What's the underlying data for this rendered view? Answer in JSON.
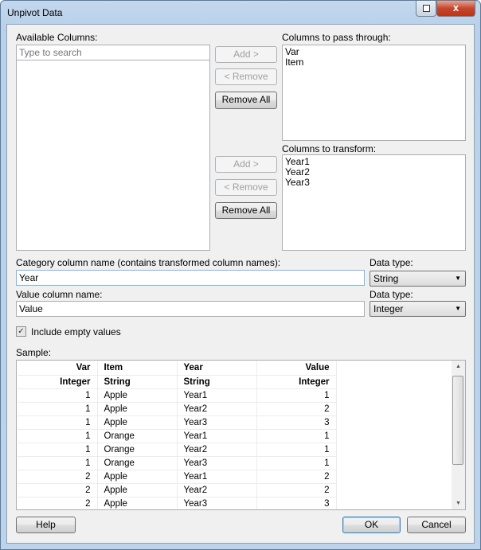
{
  "window": {
    "title": "Unpivot Data",
    "close_label": "x"
  },
  "available": {
    "label": "Available Columns:",
    "search_placeholder": "Type to search",
    "items": []
  },
  "buttons": {
    "add1": "Add >",
    "remove1": "< Remove",
    "remove_all1": "Remove All",
    "add2": "Add >",
    "remove2": "< Remove",
    "remove_all2": "Remove All",
    "help": "Help",
    "ok": "OK",
    "cancel": "Cancel"
  },
  "pass_through": {
    "label": "Columns to pass through:",
    "items": [
      "Var",
      "Item"
    ]
  },
  "transform": {
    "label": "Columns to transform:",
    "items": [
      "Year1",
      "Year2",
      "Year3"
    ]
  },
  "category": {
    "label": "Category column name (contains transformed column names):",
    "value": "Year",
    "type_label": "Data type:",
    "type_value": "String"
  },
  "value_col": {
    "label": "Value column name:",
    "value": "Value",
    "type_label": "Data type:",
    "type_value": "Integer"
  },
  "include_empty": {
    "label": "Include empty values",
    "checked": true
  },
  "sample": {
    "label": "Sample:",
    "headers": [
      "Var",
      "Item",
      "Year",
      "Value"
    ],
    "types": [
      "Integer",
      "String",
      "String",
      "Integer"
    ],
    "rows": [
      [
        "1",
        "Apple",
        "Year1",
        "1"
      ],
      [
        "1",
        "Apple",
        "Year2",
        "2"
      ],
      [
        "1",
        "Apple",
        "Year3",
        "3"
      ],
      [
        "1",
        "Orange",
        "Year1",
        "1"
      ],
      [
        "1",
        "Orange",
        "Year2",
        "1"
      ],
      [
        "1",
        "Orange",
        "Year3",
        "1"
      ],
      [
        "2",
        "Apple",
        "Year1",
        "2"
      ],
      [
        "2",
        "Apple",
        "Year2",
        "2"
      ],
      [
        "2",
        "Apple",
        "Year3",
        "3"
      ]
    ]
  }
}
